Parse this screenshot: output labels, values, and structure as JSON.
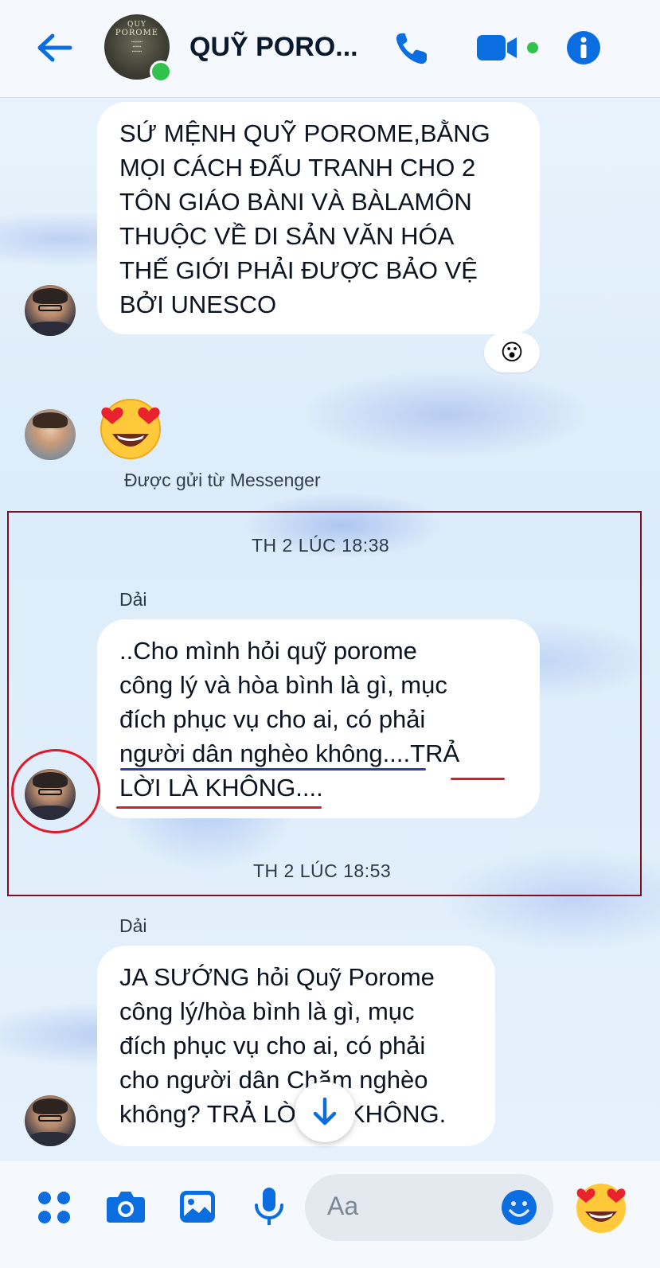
{
  "header": {
    "title": "QUỸ PORO...",
    "avatar_text": [
      "QUY",
      "POROME"
    ],
    "online": true,
    "accent_color": "#0b6ee0"
  },
  "messages": [
    {
      "text_lines": [
        "SỨ MỆNH QUỸ POROME,BẰNG",
        "MỌI CÁCH ĐẤU TRANH CHO 2",
        "TÔN GIÁO BÀNI VÀ BÀLAMÔN",
        "THUỘC VỀ DI SẢN VĂN HÓA",
        "THẾ GIỚI PHẢI ĐƯỢC BẢO VỆ",
        "BỞI UNESCO"
      ],
      "reaction": "😮"
    },
    {
      "emoji": "😍",
      "note": "Được gửi từ Messenger"
    },
    {
      "timestamp": "TH 2 LÚC 18:38",
      "sender": "Dải",
      "text_lines": [
        "..Cho mình hỏi quỹ porome",
        "công lý và hòa bình là gì, mục",
        "đích phục vụ cho ai, có phải",
        "người dân nghèo không....TRẢ",
        "LỜI LÀ KHÔNG...."
      ]
    },
    {
      "timestamp": "TH 2 LÚC 18:53",
      "sender": "Dải",
      "text_lines": [
        "JA SƯỚNG hỏi Quỹ Porome",
        "công lý/hòa bình là gì, mục",
        "đích phục vụ cho ai, có phải",
        "cho người dân Chăm nghèo",
        "không? TRẢ LỜI LÀ KHÔNG."
      ]
    }
  ],
  "composer": {
    "placeholder": "Aa",
    "send_emoji": "😍"
  },
  "annotations": {
    "box_color": "#7a1020",
    "circle_color": "#e0182a",
    "blue_underline_color": "#2a3fb5",
    "red_underline_color": "#e0182a"
  }
}
